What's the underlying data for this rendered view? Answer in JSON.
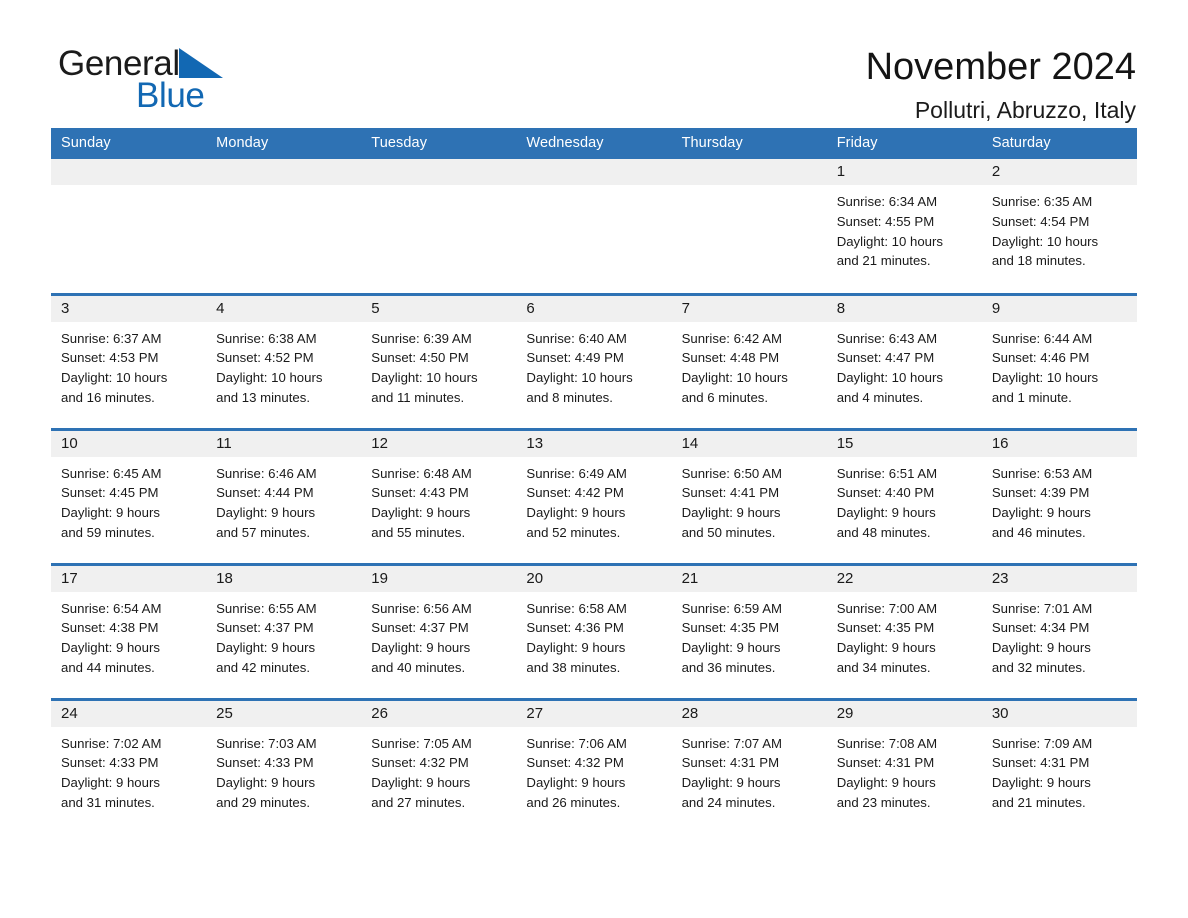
{
  "brand": {
    "word1": "General",
    "word2": "Blue",
    "triangle_icon": "brand-triangle-icon",
    "color_blue": "#1268b3",
    "color_dark": "#1b1b1b"
  },
  "header": {
    "month_title": "November 2024",
    "location": "Pollutri, Abruzzo, Italy"
  },
  "theme": {
    "header_blue": "#2e72b4",
    "date_band_gray": "#f0f0f0",
    "body_white": "#ffffff",
    "text_dark": "#1a1a1a"
  },
  "calendar": {
    "weekday_headers": [
      "Sunday",
      "Monday",
      "Tuesday",
      "Wednesday",
      "Thursday",
      "Friday",
      "Saturday"
    ],
    "weeks": [
      [
        {
          "date": "",
          "empty": true
        },
        {
          "date": "",
          "empty": true
        },
        {
          "date": "",
          "empty": true
        },
        {
          "date": "",
          "empty": true
        },
        {
          "date": "",
          "empty": true
        },
        {
          "date": "1",
          "sunrise": "Sunrise: 6:34 AM",
          "sunset": "Sunset: 4:55 PM",
          "daylight_line1": "Daylight: 10 hours",
          "daylight_line2": "and 21 minutes."
        },
        {
          "date": "2",
          "sunrise": "Sunrise: 6:35 AM",
          "sunset": "Sunset: 4:54 PM",
          "daylight_line1": "Daylight: 10 hours",
          "daylight_line2": "and 18 minutes."
        }
      ],
      [
        {
          "date": "3",
          "sunrise": "Sunrise: 6:37 AM",
          "sunset": "Sunset: 4:53 PM",
          "daylight_line1": "Daylight: 10 hours",
          "daylight_line2": "and 16 minutes."
        },
        {
          "date": "4",
          "sunrise": "Sunrise: 6:38 AM",
          "sunset": "Sunset: 4:52 PM",
          "daylight_line1": "Daylight: 10 hours",
          "daylight_line2": "and 13 minutes."
        },
        {
          "date": "5",
          "sunrise": "Sunrise: 6:39 AM",
          "sunset": "Sunset: 4:50 PM",
          "daylight_line1": "Daylight: 10 hours",
          "daylight_line2": "and 11 minutes."
        },
        {
          "date": "6",
          "sunrise": "Sunrise: 6:40 AM",
          "sunset": "Sunset: 4:49 PM",
          "daylight_line1": "Daylight: 10 hours",
          "daylight_line2": "and 8 minutes."
        },
        {
          "date": "7",
          "sunrise": "Sunrise: 6:42 AM",
          "sunset": "Sunset: 4:48 PM",
          "daylight_line1": "Daylight: 10 hours",
          "daylight_line2": "and 6 minutes."
        },
        {
          "date": "8",
          "sunrise": "Sunrise: 6:43 AM",
          "sunset": "Sunset: 4:47 PM",
          "daylight_line1": "Daylight: 10 hours",
          "daylight_line2": "and 4 minutes."
        },
        {
          "date": "9",
          "sunrise": "Sunrise: 6:44 AM",
          "sunset": "Sunset: 4:46 PM",
          "daylight_line1": "Daylight: 10 hours",
          "daylight_line2": "and 1 minute."
        }
      ],
      [
        {
          "date": "10",
          "sunrise": "Sunrise: 6:45 AM",
          "sunset": "Sunset: 4:45 PM",
          "daylight_line1": "Daylight: 9 hours",
          "daylight_line2": "and 59 minutes."
        },
        {
          "date": "11",
          "sunrise": "Sunrise: 6:46 AM",
          "sunset": "Sunset: 4:44 PM",
          "daylight_line1": "Daylight: 9 hours",
          "daylight_line2": "and 57 minutes."
        },
        {
          "date": "12",
          "sunrise": "Sunrise: 6:48 AM",
          "sunset": "Sunset: 4:43 PM",
          "daylight_line1": "Daylight: 9 hours",
          "daylight_line2": "and 55 minutes."
        },
        {
          "date": "13",
          "sunrise": "Sunrise: 6:49 AM",
          "sunset": "Sunset: 4:42 PM",
          "daylight_line1": "Daylight: 9 hours",
          "daylight_line2": "and 52 minutes."
        },
        {
          "date": "14",
          "sunrise": "Sunrise: 6:50 AM",
          "sunset": "Sunset: 4:41 PM",
          "daylight_line1": "Daylight: 9 hours",
          "daylight_line2": "and 50 minutes."
        },
        {
          "date": "15",
          "sunrise": "Sunrise: 6:51 AM",
          "sunset": "Sunset: 4:40 PM",
          "daylight_line1": "Daylight: 9 hours",
          "daylight_line2": "and 48 minutes."
        },
        {
          "date": "16",
          "sunrise": "Sunrise: 6:53 AM",
          "sunset": "Sunset: 4:39 PM",
          "daylight_line1": "Daylight: 9 hours",
          "daylight_line2": "and 46 minutes."
        }
      ],
      [
        {
          "date": "17",
          "sunrise": "Sunrise: 6:54 AM",
          "sunset": "Sunset: 4:38 PM",
          "daylight_line1": "Daylight: 9 hours",
          "daylight_line2": "and 44 minutes."
        },
        {
          "date": "18",
          "sunrise": "Sunrise: 6:55 AM",
          "sunset": "Sunset: 4:37 PM",
          "daylight_line1": "Daylight: 9 hours",
          "daylight_line2": "and 42 minutes."
        },
        {
          "date": "19",
          "sunrise": "Sunrise: 6:56 AM",
          "sunset": "Sunset: 4:37 PM",
          "daylight_line1": "Daylight: 9 hours",
          "daylight_line2": "and 40 minutes."
        },
        {
          "date": "20",
          "sunrise": "Sunrise: 6:58 AM",
          "sunset": "Sunset: 4:36 PM",
          "daylight_line1": "Daylight: 9 hours",
          "daylight_line2": "and 38 minutes."
        },
        {
          "date": "21",
          "sunrise": "Sunrise: 6:59 AM",
          "sunset": "Sunset: 4:35 PM",
          "daylight_line1": "Daylight: 9 hours",
          "daylight_line2": "and 36 minutes."
        },
        {
          "date": "22",
          "sunrise": "Sunrise: 7:00 AM",
          "sunset": "Sunset: 4:35 PM",
          "daylight_line1": "Daylight: 9 hours",
          "daylight_line2": "and 34 minutes."
        },
        {
          "date": "23",
          "sunrise": "Sunrise: 7:01 AM",
          "sunset": "Sunset: 4:34 PM",
          "daylight_line1": "Daylight: 9 hours",
          "daylight_line2": "and 32 minutes."
        }
      ],
      [
        {
          "date": "24",
          "sunrise": "Sunrise: 7:02 AM",
          "sunset": "Sunset: 4:33 PM",
          "daylight_line1": "Daylight: 9 hours",
          "daylight_line2": "and 31 minutes."
        },
        {
          "date": "25",
          "sunrise": "Sunrise: 7:03 AM",
          "sunset": "Sunset: 4:33 PM",
          "daylight_line1": "Daylight: 9 hours",
          "daylight_line2": "and 29 minutes."
        },
        {
          "date": "26",
          "sunrise": "Sunrise: 7:05 AM",
          "sunset": "Sunset: 4:32 PM",
          "daylight_line1": "Daylight: 9 hours",
          "daylight_line2": "and 27 minutes."
        },
        {
          "date": "27",
          "sunrise": "Sunrise: 7:06 AM",
          "sunset": "Sunset: 4:32 PM",
          "daylight_line1": "Daylight: 9 hours",
          "daylight_line2": "and 26 minutes."
        },
        {
          "date": "28",
          "sunrise": "Sunrise: 7:07 AM",
          "sunset": "Sunset: 4:31 PM",
          "daylight_line1": "Daylight: 9 hours",
          "daylight_line2": "and 24 minutes."
        },
        {
          "date": "29",
          "sunrise": "Sunrise: 7:08 AM",
          "sunset": "Sunset: 4:31 PM",
          "daylight_line1": "Daylight: 9 hours",
          "daylight_line2": "and 23 minutes."
        },
        {
          "date": "30",
          "sunrise": "Sunrise: 7:09 AM",
          "sunset": "Sunset: 4:31 PM",
          "daylight_line1": "Daylight: 9 hours",
          "daylight_line2": "and 21 minutes."
        }
      ]
    ]
  }
}
